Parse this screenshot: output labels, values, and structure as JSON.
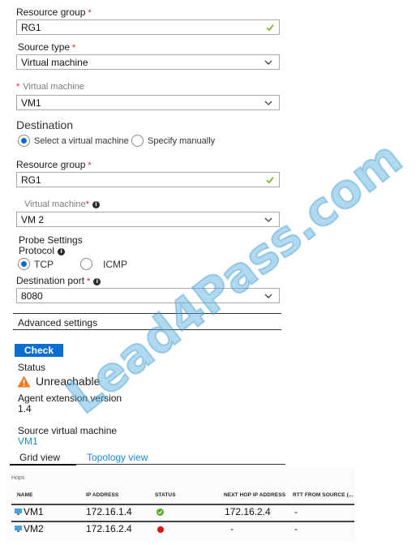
{
  "source": {
    "resource_group_label": "Resource group",
    "resource_group_value": "RG1",
    "source_type_label": "Source type",
    "source_type_value": "Virtual machine",
    "virtual_machine_label": "Virtual machine",
    "virtual_machine_value": "VM1"
  },
  "destination": {
    "title": "Destination",
    "radio_select_vm": "Select a virtual machine",
    "radio_specify_manually": "Specify manually",
    "selected_option": "Select a virtual machine",
    "resource_group_label": "Resource group",
    "resource_group_value": "RG1",
    "virtual_machine_label": "Virtual machine",
    "virtual_machine_value": "VM 2"
  },
  "probe": {
    "title": "Probe Settings",
    "protocol_label": "Protocol",
    "protocol_tcp": "TCP",
    "protocol_icmp": "ICMP",
    "selected_protocol": "TCP",
    "destination_port_label": "Destination port",
    "destination_port_value": "8080"
  },
  "advanced_settings_label": "Advanced settings",
  "check_button_label": "Check",
  "results": {
    "status_label": "Status",
    "status_value": "Unreachable",
    "agent_version_label": "Agent extension version",
    "agent_version_value": "1.4",
    "source_vm_label": "Source virtual machine",
    "source_vm_value": "VM1"
  },
  "tabs": {
    "grid_view": "Grid view",
    "topology_view": "Topology view",
    "active": "Grid view"
  },
  "hops": {
    "title": "Hops",
    "columns": [
      "NAME",
      "IP ADDRESS",
      "STATUS",
      "NEXT HOP IP ADDRESS",
      "RTT FROM SOURCE (..."
    ],
    "rows": [
      {
        "name": "VM1",
        "ip": "172.16.1.4",
        "status": "success",
        "next_hop": "172.16.2.4",
        "rtt": "-"
      },
      {
        "name": "VM2",
        "ip": "172.16.2.4",
        "status": "error",
        "next_hop": "-",
        "rtt": "-"
      }
    ]
  },
  "colors": {
    "accent": "#0a6ed1",
    "link": "#1a8ad4",
    "required": "#e02020",
    "valid_check": "#7ab929",
    "warning": "#f07a20",
    "status_success": "#5aa82a",
    "status_error": "#e01010"
  },
  "watermark": "Lead4Pass.com"
}
